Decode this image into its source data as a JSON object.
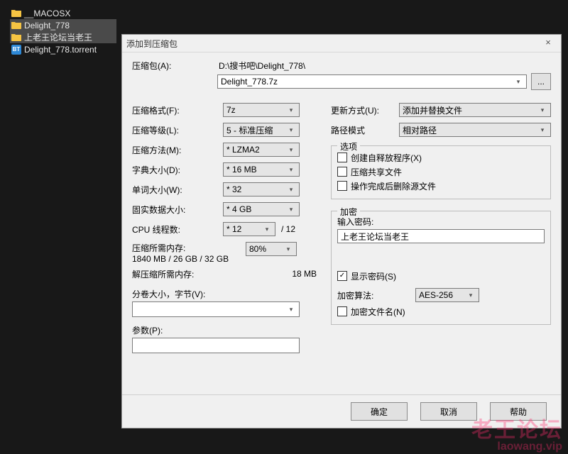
{
  "tree": {
    "items": [
      {
        "label": "__MACOSX",
        "kind": "folder",
        "selected": false
      },
      {
        "label": "Delight_778",
        "kind": "folder",
        "selected": true
      },
      {
        "label": "上老王论坛当老王",
        "kind": "folder",
        "selected": true
      },
      {
        "label": "Delight_778.torrent",
        "kind": "torrent",
        "selected": false
      }
    ]
  },
  "dialog": {
    "title": "添加到压缩包",
    "archive": {
      "label": "压缩包(A):",
      "crumb": "D:\\搜书吧\\Delight_778\\",
      "value": "Delight_778.7z",
      "browse": "..."
    },
    "left": {
      "format": {
        "label": "压缩格式(F):",
        "value": "7z"
      },
      "level": {
        "label": "压缩等级(L):",
        "value": "5 - 标准压缩"
      },
      "method": {
        "label": "压缩方法(M):",
        "value": "* LZMA2"
      },
      "dict": {
        "label": "字典大小(D):",
        "value": "* 16 MB"
      },
      "word": {
        "label": "单词大小(W):",
        "value": "* 32"
      },
      "solid": {
        "label": "固实数据大小:",
        "value": "* 4 GB"
      },
      "threads": {
        "label": "CPU 线程数:",
        "value": "* 12",
        "of": "/ 12"
      },
      "mem_pack": {
        "label": "压缩所需内存:",
        "sub": "1840 MB / 26 GB / 32 GB",
        "pct": "80%"
      },
      "mem_unpack": {
        "label": "解压缩所需内存:",
        "value": "18 MB"
      },
      "split": {
        "label": "分卷大小，字节(V):"
      },
      "params": {
        "label": "参数(P):"
      }
    },
    "right": {
      "update": {
        "label": "更新方式(U):",
        "value": "添加并替换文件"
      },
      "path": {
        "label": "路径模式",
        "value": "相对路径"
      },
      "options": {
        "legend": "选项",
        "sfx": {
          "label": "创建自释放程序(X)",
          "checked": false
        },
        "shared": {
          "label": "压缩共享文件",
          "checked": false
        },
        "delete": {
          "label": "操作完成后删除源文件",
          "checked": false
        }
      },
      "encryption": {
        "legend": "加密",
        "pw_label": "输入密码:",
        "pw_value": "上老王论坛当老王",
        "show_pw": {
          "label": "显示密码(S)",
          "checked": true
        },
        "algo": {
          "label": "加密算法:",
          "value": "AES-256"
        },
        "encname": {
          "label": "加密文件名(N)",
          "checked": false
        }
      }
    },
    "buttons": {
      "ok": "确定",
      "cancel": "取消",
      "help": "帮助"
    }
  },
  "watermark": {
    "cn": "老王论坛",
    "en": "laowang.vip"
  }
}
